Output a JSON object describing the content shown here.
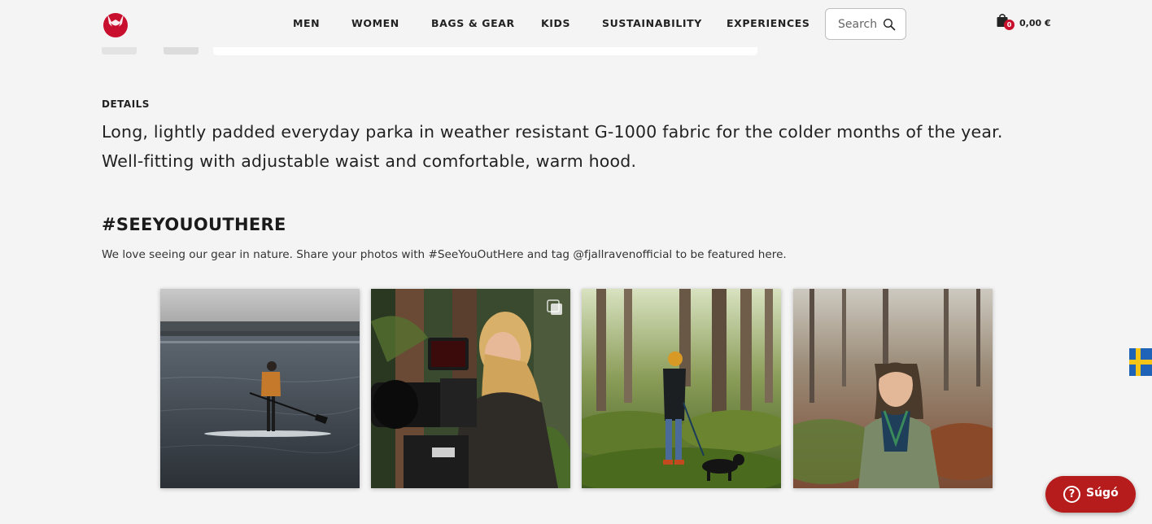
{
  "header": {
    "logo": "fox-logo",
    "nav": [
      {
        "label": "MEN"
      },
      {
        "label": "WOMEN"
      },
      {
        "label": "BAGS & GEAR"
      },
      {
        "label": "KIDS"
      },
      {
        "label": "SUSTAINABILITY"
      },
      {
        "label": "EXPERIENCES"
      }
    ],
    "search": {
      "placeholder": "Search",
      "icon": "search-icon"
    },
    "cart": {
      "count": "0",
      "total": "0,00 €",
      "icon": "shopping-bag-icon"
    }
  },
  "details": {
    "heading": "DETAILS",
    "text": "Long, lightly padded everyday parka in weather resistant G-1000 fabric for the colder months of the year. Well-fitting with adjustable waist and comfortable, warm hood."
  },
  "seeyououthere": {
    "heading": "#SEEYOUOUTHERE",
    "text": "We love seeing our gear in nature. Share your photos with #SeeYouOutHere and tag @fjallravenofficial to be featured here."
  },
  "gallery": [
    {
      "scene": "paddleboarder-on-lake"
    },
    {
      "scene": "woman-with-film-camera",
      "multi_photo_icon": "multiple-photos-icon"
    },
    {
      "scene": "hiker-with-dog-in-forest"
    },
    {
      "scene": "woman-in-autumn-woods"
    }
  ],
  "language_flag": "sweden-flag-icon",
  "help": {
    "label": "Súgó",
    "icon": "question-mark-icon"
  },
  "colors": {
    "background": "#f4f4f4",
    "brand_red": "#b71c1c",
    "logo_red": "#c8102e",
    "text": "#222222"
  }
}
